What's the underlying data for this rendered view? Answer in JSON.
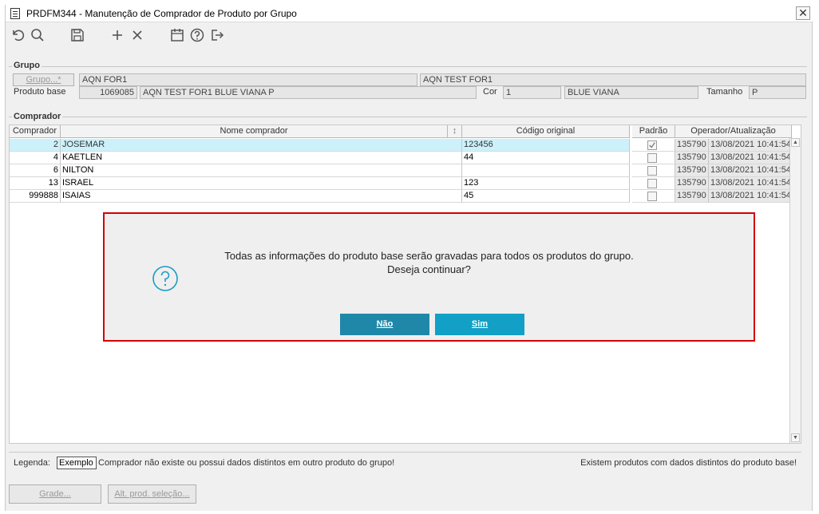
{
  "window": {
    "title": "PRDFM344 - Manutenção de Comprador de Produto por Grupo",
    "close_glyph": "✕"
  },
  "toolbar": {
    "icons": [
      "undo-icon",
      "search-icon",
      "save-icon",
      "add-icon",
      "delete-icon",
      "calendar-icon",
      "help-icon",
      "exit-icon"
    ]
  },
  "grupo": {
    "title": "Grupo",
    "button_label": "Grupo...*",
    "code_value": "AQN FOR1",
    "desc_value": "AQN TEST FOR1",
    "produto_base_label": "Produto base",
    "produto_base_code": "1069085",
    "produto_base_desc": "AQN TEST FOR1 BLUE VIANA P",
    "cor_label": "Cor",
    "cor_code": "1",
    "cor_desc": "BLUE VIANA",
    "tamanho_label": "Tamanho",
    "tamanho_value": "P"
  },
  "comprador": {
    "title": "Comprador",
    "columns": {
      "comprador": "Comprador",
      "nome": "Nome comprador",
      "sort_glyph": "↕",
      "codigo": "Código original",
      "padrao": "Padrão",
      "operador": "Operador/Atualização"
    },
    "rows": [
      {
        "comprador": "2",
        "nome": "JOSEMAR",
        "codigo": "123456",
        "padrao": true,
        "operador": "135790",
        "atualizacao": "13/08/2021 10:41:54"
      },
      {
        "comprador": "4",
        "nome": "KAETLEN",
        "codigo": "44",
        "padrao": false,
        "operador": "135790",
        "atualizacao": "13/08/2021 10:41:54"
      },
      {
        "comprador": "6",
        "nome": "NILTON",
        "codigo": "",
        "padrao": false,
        "operador": "135790",
        "atualizacao": "13/08/2021 10:41:54"
      },
      {
        "comprador": "13",
        "nome": "ISRAEL",
        "codigo": "123",
        "padrao": false,
        "operador": "135790",
        "atualizacao": "13/08/2021 10:41:54"
      },
      {
        "comprador": "999888",
        "nome": "ISAIAS",
        "codigo": "45",
        "padrao": false,
        "operador": "135790",
        "atualizacao": "13/08/2021 10:41:54"
      }
    ]
  },
  "dialog": {
    "message_line1": "Todas as informações do produto base serão gravadas para todos os produtos do grupo.",
    "message_line2": "Deseja continuar?",
    "no_label": "Não",
    "yes_label": "Sim",
    "no_color": "#1f88a8",
    "yes_color": "#12a0c6",
    "border_color": "#d40000"
  },
  "legend": {
    "label": "Legenda:",
    "example": "Exemplo",
    "text": "Comprador não existe ou possui dados distintos em outro produto do grupo!",
    "right_text": "Existem produtos com dados distintos do produto base!"
  },
  "footer": {
    "grade_label": "Grade...",
    "alt_label": "Alt. prod. seleção..."
  }
}
